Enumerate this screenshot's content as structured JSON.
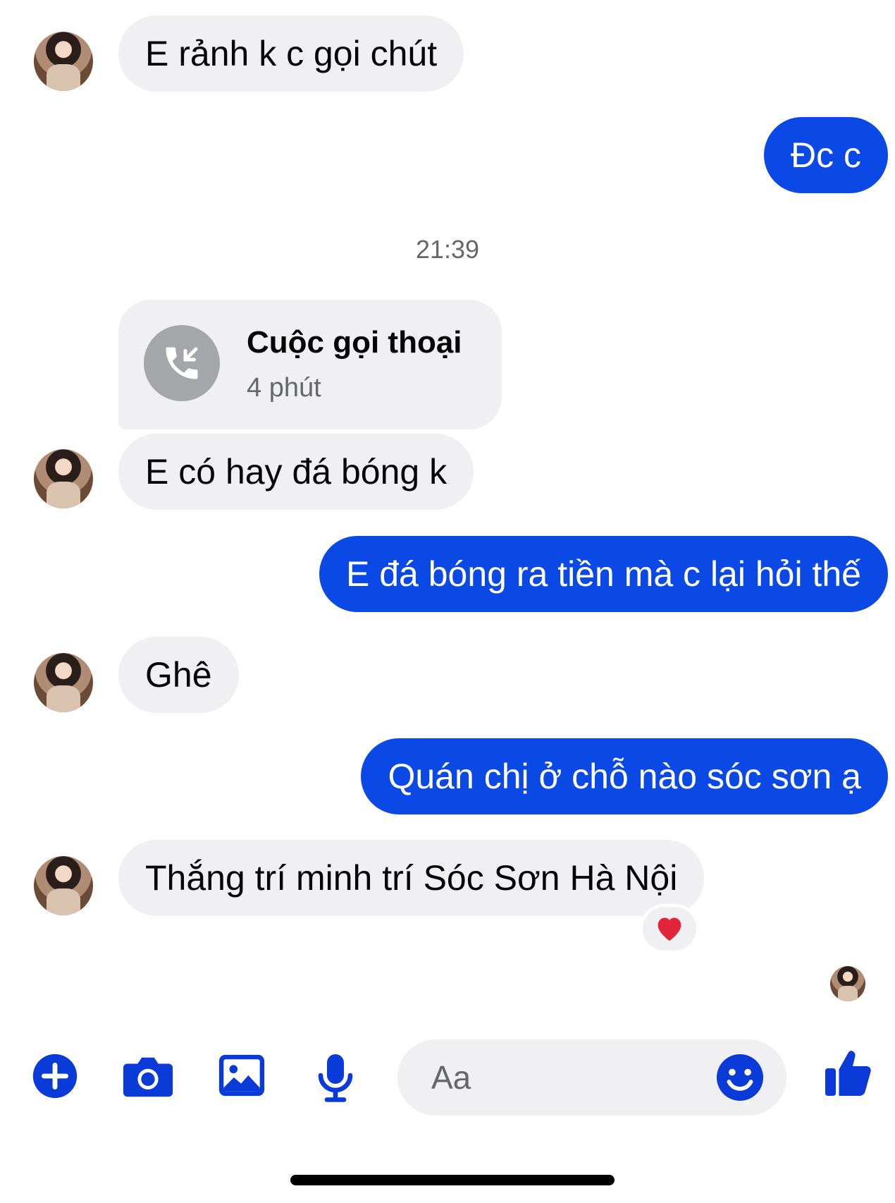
{
  "messages": [
    {
      "text": "E rảnh k c gọi chút"
    },
    {
      "text": "Đc c"
    },
    {
      "text": "E có hay đá bóng k"
    },
    {
      "text": "E đá bóng ra tiền mà c lại hỏi thế"
    },
    {
      "text": "Ghê"
    },
    {
      "text": "Quán chị ở chỗ nào sóc sơn ạ"
    },
    {
      "text": "Thắng trí minh trí Sóc Sơn Hà Nội"
    }
  ],
  "timestamp": "21:39",
  "call": {
    "title": "Cuộc gọi thoại",
    "duration": "4 phút"
  },
  "reaction": "heart",
  "composer": {
    "placeholder": "Aa"
  },
  "colors": {
    "outgoing_bubble": "#0a49e6",
    "incoming_bubble": "#f0f0f3",
    "accent": "#0a3ad8"
  }
}
